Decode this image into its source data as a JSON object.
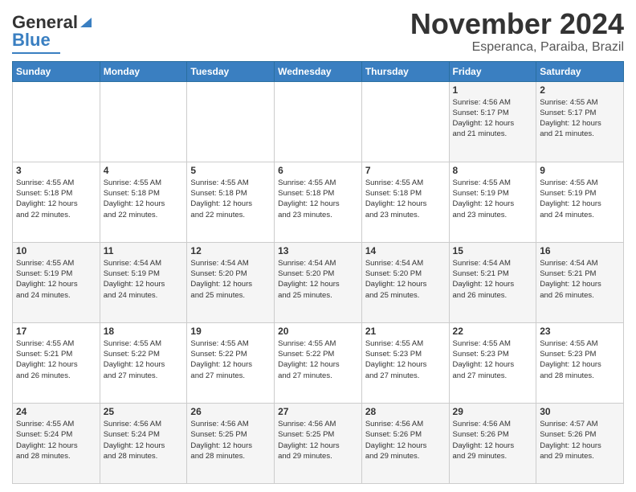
{
  "header": {
    "logo_line1": "General",
    "logo_line2": "Blue",
    "month": "November 2024",
    "location": "Esperanca, Paraiba, Brazil"
  },
  "weekdays": [
    "Sunday",
    "Monday",
    "Tuesday",
    "Wednesday",
    "Thursday",
    "Friday",
    "Saturday"
  ],
  "weeks": [
    [
      {
        "day": "",
        "info": ""
      },
      {
        "day": "",
        "info": ""
      },
      {
        "day": "",
        "info": ""
      },
      {
        "day": "",
        "info": ""
      },
      {
        "day": "",
        "info": ""
      },
      {
        "day": "1",
        "info": "Sunrise: 4:56 AM\nSunset: 5:17 PM\nDaylight: 12 hours\nand 21 minutes."
      },
      {
        "day": "2",
        "info": "Sunrise: 4:55 AM\nSunset: 5:17 PM\nDaylight: 12 hours\nand 21 minutes."
      }
    ],
    [
      {
        "day": "3",
        "info": "Sunrise: 4:55 AM\nSunset: 5:18 PM\nDaylight: 12 hours\nand 22 minutes."
      },
      {
        "day": "4",
        "info": "Sunrise: 4:55 AM\nSunset: 5:18 PM\nDaylight: 12 hours\nand 22 minutes."
      },
      {
        "day": "5",
        "info": "Sunrise: 4:55 AM\nSunset: 5:18 PM\nDaylight: 12 hours\nand 22 minutes."
      },
      {
        "day": "6",
        "info": "Sunrise: 4:55 AM\nSunset: 5:18 PM\nDaylight: 12 hours\nand 23 minutes."
      },
      {
        "day": "7",
        "info": "Sunrise: 4:55 AM\nSunset: 5:18 PM\nDaylight: 12 hours\nand 23 minutes."
      },
      {
        "day": "8",
        "info": "Sunrise: 4:55 AM\nSunset: 5:19 PM\nDaylight: 12 hours\nand 23 minutes."
      },
      {
        "day": "9",
        "info": "Sunrise: 4:55 AM\nSunset: 5:19 PM\nDaylight: 12 hours\nand 24 minutes."
      }
    ],
    [
      {
        "day": "10",
        "info": "Sunrise: 4:55 AM\nSunset: 5:19 PM\nDaylight: 12 hours\nand 24 minutes."
      },
      {
        "day": "11",
        "info": "Sunrise: 4:54 AM\nSunset: 5:19 PM\nDaylight: 12 hours\nand 24 minutes."
      },
      {
        "day": "12",
        "info": "Sunrise: 4:54 AM\nSunset: 5:20 PM\nDaylight: 12 hours\nand 25 minutes."
      },
      {
        "day": "13",
        "info": "Sunrise: 4:54 AM\nSunset: 5:20 PM\nDaylight: 12 hours\nand 25 minutes."
      },
      {
        "day": "14",
        "info": "Sunrise: 4:54 AM\nSunset: 5:20 PM\nDaylight: 12 hours\nand 25 minutes."
      },
      {
        "day": "15",
        "info": "Sunrise: 4:54 AM\nSunset: 5:21 PM\nDaylight: 12 hours\nand 26 minutes."
      },
      {
        "day": "16",
        "info": "Sunrise: 4:54 AM\nSunset: 5:21 PM\nDaylight: 12 hours\nand 26 minutes."
      }
    ],
    [
      {
        "day": "17",
        "info": "Sunrise: 4:55 AM\nSunset: 5:21 PM\nDaylight: 12 hours\nand 26 minutes."
      },
      {
        "day": "18",
        "info": "Sunrise: 4:55 AM\nSunset: 5:22 PM\nDaylight: 12 hours\nand 27 minutes."
      },
      {
        "day": "19",
        "info": "Sunrise: 4:55 AM\nSunset: 5:22 PM\nDaylight: 12 hours\nand 27 minutes."
      },
      {
        "day": "20",
        "info": "Sunrise: 4:55 AM\nSunset: 5:22 PM\nDaylight: 12 hours\nand 27 minutes."
      },
      {
        "day": "21",
        "info": "Sunrise: 4:55 AM\nSunset: 5:23 PM\nDaylight: 12 hours\nand 27 minutes."
      },
      {
        "day": "22",
        "info": "Sunrise: 4:55 AM\nSunset: 5:23 PM\nDaylight: 12 hours\nand 27 minutes."
      },
      {
        "day": "23",
        "info": "Sunrise: 4:55 AM\nSunset: 5:23 PM\nDaylight: 12 hours\nand 28 minutes."
      }
    ],
    [
      {
        "day": "24",
        "info": "Sunrise: 4:55 AM\nSunset: 5:24 PM\nDaylight: 12 hours\nand 28 minutes."
      },
      {
        "day": "25",
        "info": "Sunrise: 4:56 AM\nSunset: 5:24 PM\nDaylight: 12 hours\nand 28 minutes."
      },
      {
        "day": "26",
        "info": "Sunrise: 4:56 AM\nSunset: 5:25 PM\nDaylight: 12 hours\nand 28 minutes."
      },
      {
        "day": "27",
        "info": "Sunrise: 4:56 AM\nSunset: 5:25 PM\nDaylight: 12 hours\nand 29 minutes."
      },
      {
        "day": "28",
        "info": "Sunrise: 4:56 AM\nSunset: 5:26 PM\nDaylight: 12 hours\nand 29 minutes."
      },
      {
        "day": "29",
        "info": "Sunrise: 4:56 AM\nSunset: 5:26 PM\nDaylight: 12 hours\nand 29 minutes."
      },
      {
        "day": "30",
        "info": "Sunrise: 4:57 AM\nSunset: 5:26 PM\nDaylight: 12 hours\nand 29 minutes."
      }
    ]
  ]
}
